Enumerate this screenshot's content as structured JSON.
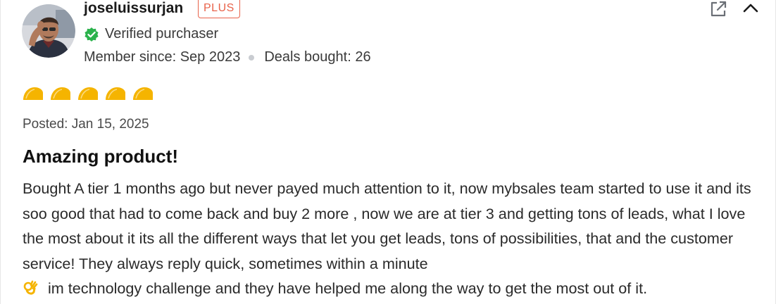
{
  "reviewer": {
    "username": "joseluissurjan",
    "badge": "PLUS",
    "verified_label": "Verified purchaser",
    "member_since": "Member since: Sep 2023",
    "deals_bought": "Deals bought: 26",
    "avatar_icon": "user-avatar-photo"
  },
  "actions": {
    "share_icon": "external-link-icon",
    "collapse_icon": "chevron-up-icon"
  },
  "review": {
    "rating": 5,
    "rating_max": 5,
    "rating_icon": "taco-icon",
    "posted": "Posted: Jan 15, 2025",
    "title": "Amazing product!",
    "body_main": "Bought A tier 1 months ago but never payed much attention to it, now mybsales team started to use it and its soo good that had to come back and buy 2 more , now we are at tier 3 and getting tons of leads, what I love the most about it its all the different ways that let you get leads, tons of possibilities, that and the customer service! They always reply quick, sometimes within a minute",
    "body_emoji": "ok-hand-emoji",
    "body_tail": "im technology challenge and they have helped me along the way to get the most out of it."
  },
  "colors": {
    "badge": "#e8624a",
    "verified": "#2bb24c",
    "taco": "#f5b400",
    "text": "#2a2a2a"
  }
}
